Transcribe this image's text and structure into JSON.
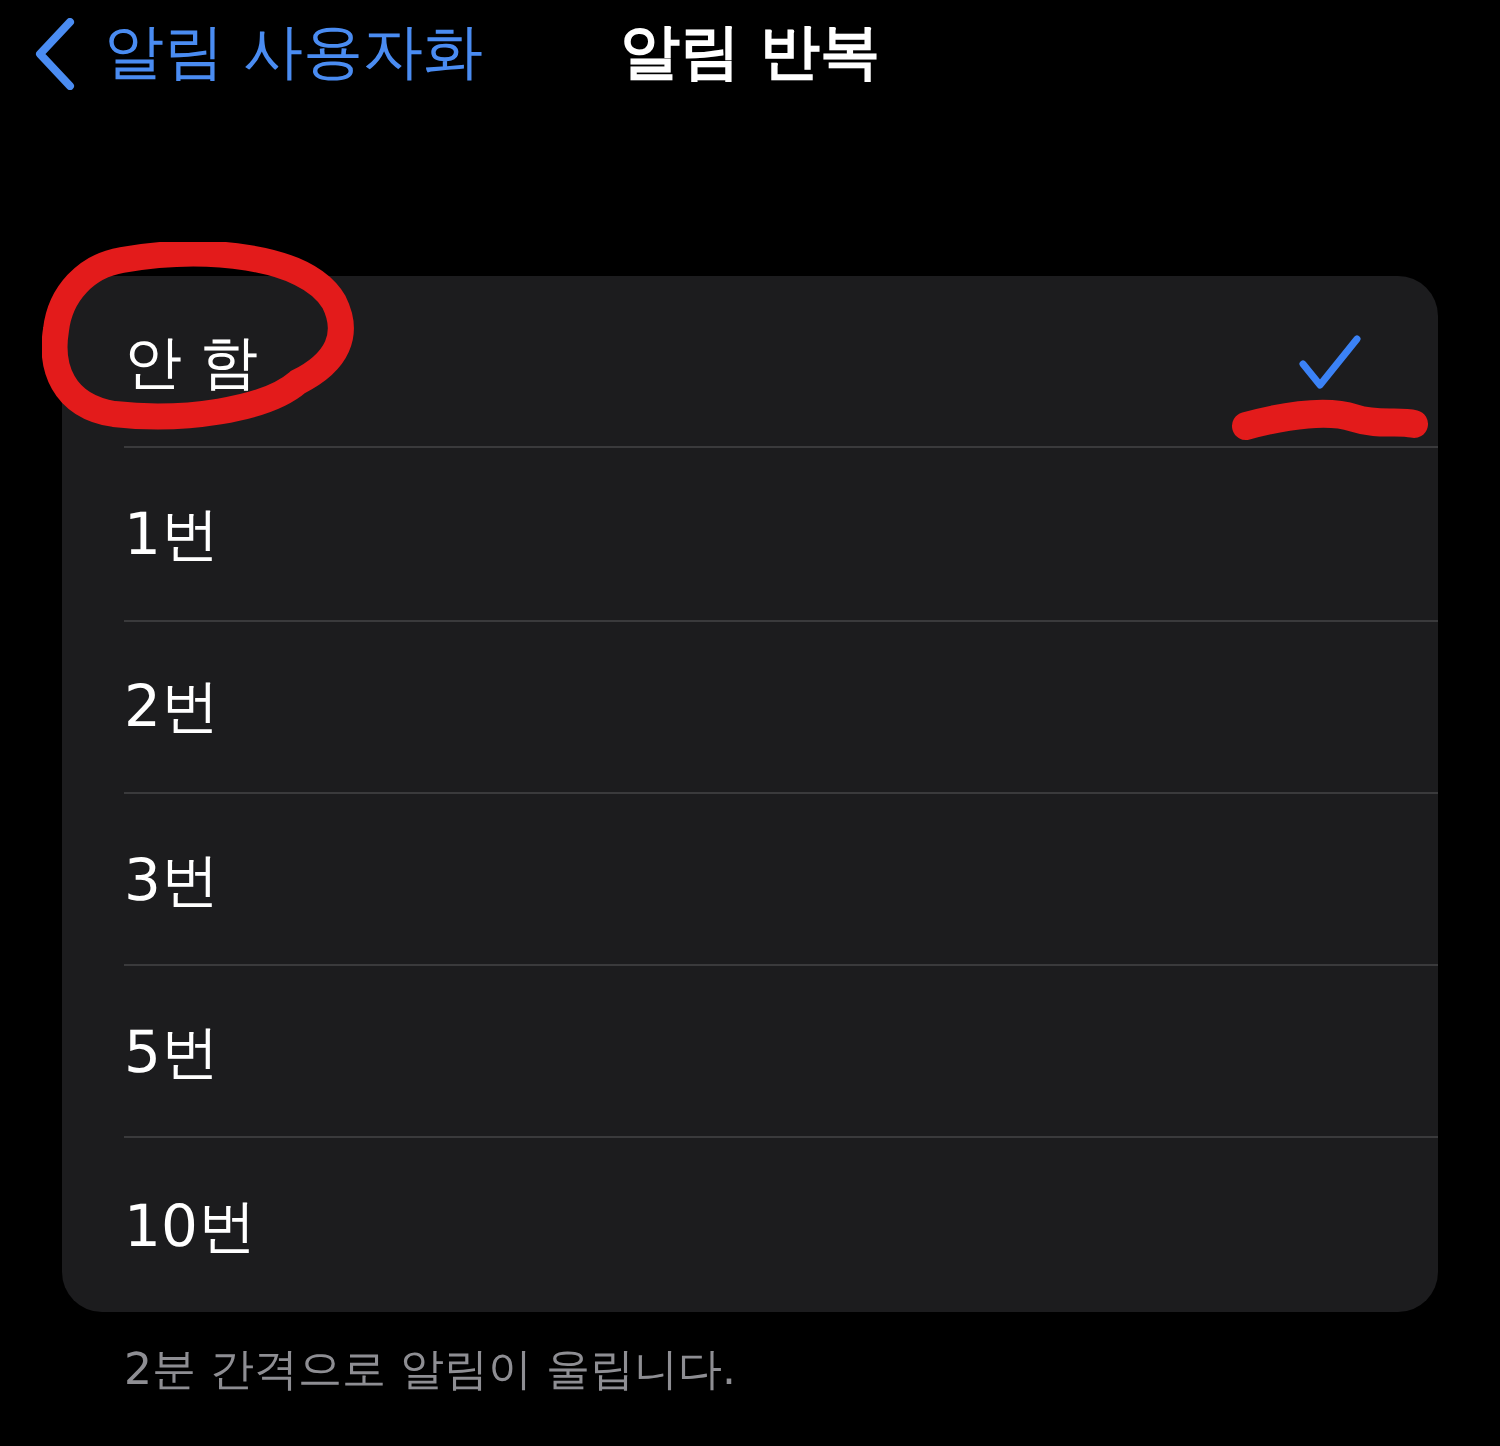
{
  "nav": {
    "back_label": "알림 사용자화",
    "title": "알림 반복"
  },
  "options": [
    {
      "label": "안 함",
      "selected": true,
      "circled": true,
      "check_scribbled": true
    },
    {
      "label": "1번",
      "selected": false,
      "circled": false,
      "check_scribbled": false
    },
    {
      "label": "2번",
      "selected": false,
      "circled": false,
      "check_scribbled": false
    },
    {
      "label": "3번",
      "selected": false,
      "circled": false,
      "check_scribbled": false
    },
    {
      "label": "5번",
      "selected": false,
      "circled": false,
      "check_scribbled": false
    },
    {
      "label": "10번",
      "selected": false,
      "circled": false,
      "check_scribbled": false
    }
  ],
  "footer": "2분 간격으로 알림이 울립니다."
}
